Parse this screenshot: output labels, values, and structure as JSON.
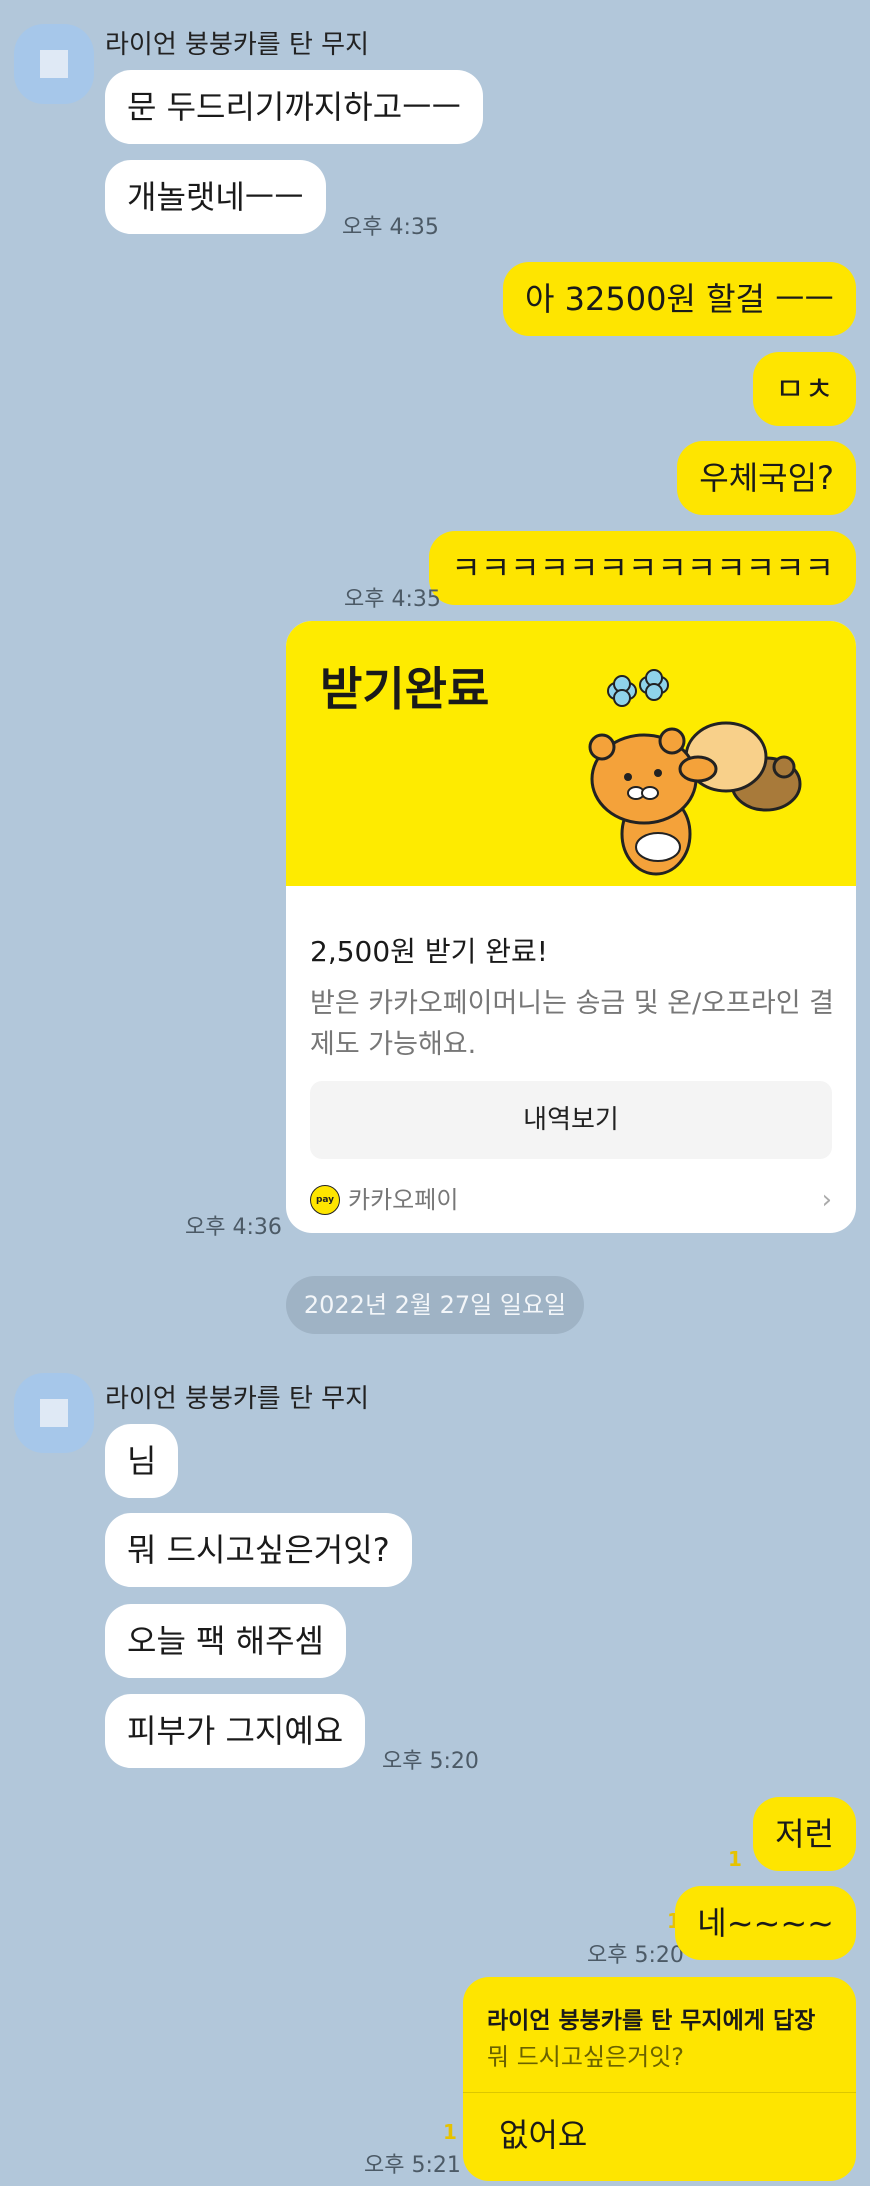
{
  "chat": {
    "sender_name": "라이언 붕붕카를 탄 무지",
    "messages_in_1": [
      "문 두드리기까지하고ㅡㅡ",
      "개놀랫네ㅡㅡ"
    ],
    "time_in_1": "오후 4:35",
    "messages_out_1": [
      "아 32500원 할걸 ㅡㅡ",
      "ㅁㅊ",
      "우체국임?",
      "ㅋㅋㅋㅋㅋㅋㅋㅋㅋㅋㅋㅋㅋ"
    ],
    "time_out_1": "오후 4:35",
    "pay_card": {
      "title": "받기완료",
      "heading": "2,500원 받기 완료!",
      "description": "받은 카카오페이머니는 송금 및 온/오프라인 결제도 가능해요.",
      "button": "내역보기",
      "brand": "카카오페이",
      "logo_text": "pay",
      "time": "오후 4:36"
    },
    "date_divider": "2022년 2월 27일 일요일",
    "messages_in_2": [
      "님",
      "뭐 드시고싶은거잇?",
      "오늘 팩 해주셈",
      "피부가 그지예요"
    ],
    "time_in_2": "오후 5:20",
    "messages_out_2": [
      "저런",
      "네~~~~"
    ],
    "unread_1": "1",
    "unread_2": "1",
    "time_out_2": "오후 5:20",
    "reply": {
      "to": "라이언 붕붕카를 탄 무지에게 답장",
      "quote": "뭐 드시고싶은거잇?",
      "message": "없어요",
      "unread": "1",
      "time": "오후 5:21"
    }
  },
  "colors": {
    "background": "#b2c7da",
    "outgoing_bubble": "#fee500",
    "incoming_bubble": "#ffffff",
    "card_header": "#feeb00"
  }
}
